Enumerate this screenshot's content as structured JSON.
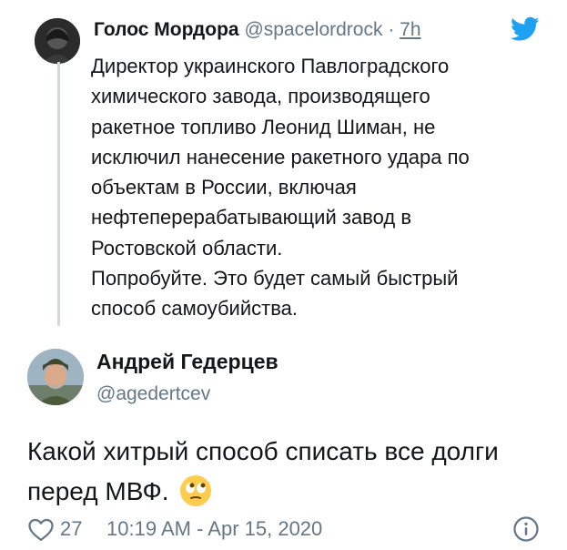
{
  "quoted": {
    "author_name": "Голос Мордора",
    "handle": "@spacelordrock",
    "separator": " · ",
    "time": "7h",
    "lines": [
      "Директор украинского Павлоградского",
      "химического завода, производящего",
      "ракетное топливо Леонид Шиман, не",
      "исключил нанесение ракетного удара по",
      "объектам в России, включая",
      "нефтеперерабатывающий завод в",
      "Ростовской области.",
      "Попробуйте. Это будет самый быстрый",
      "способ самоубийства."
    ]
  },
  "tweet": {
    "author_name": "Андрей Гедерцев",
    "handle": "@agedertcev",
    "text": "Какой хитрый способ списать все долги перед МВФ.",
    "emoji": "face-with-rolling-eyes",
    "likes": "27",
    "datetime": "10:19 AM - Apr 15, 2020"
  },
  "icons": {
    "twitter": "twitter-bird-icon",
    "heart": "heart-icon",
    "info": "info-icon"
  },
  "colors": {
    "twitter_blue": "#1da1f2",
    "secondary_text": "#657786",
    "thread_line": "#cfd9de",
    "primary_text": "#14171a"
  }
}
